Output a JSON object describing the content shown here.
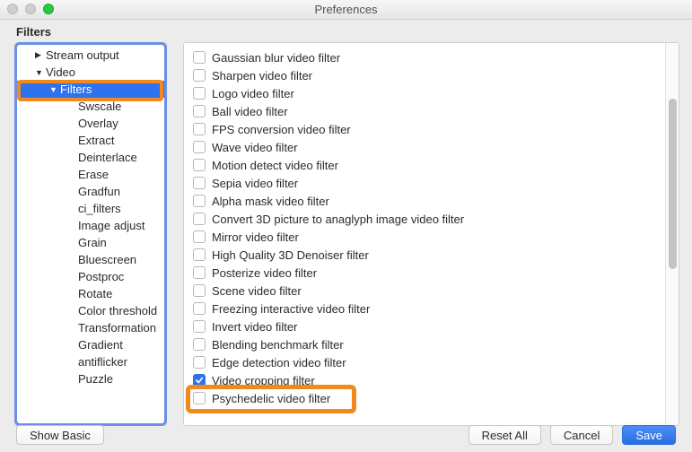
{
  "window": {
    "title": "Preferences"
  },
  "section_title": "Filters",
  "sidebar": {
    "items": [
      {
        "label": "Stream output",
        "arrow": "▶",
        "level": 1,
        "selected": false
      },
      {
        "label": "Video",
        "arrow": "▼",
        "level": 1,
        "selected": false
      },
      {
        "label": "Filters",
        "arrow": "▼",
        "level": 2,
        "selected": true
      },
      {
        "label": "Swscale",
        "arrow": "",
        "level": 3,
        "selected": false
      },
      {
        "label": "Overlay",
        "arrow": "",
        "level": 3,
        "selected": false
      },
      {
        "label": "Extract",
        "arrow": "",
        "level": 3,
        "selected": false
      },
      {
        "label": "Deinterlace",
        "arrow": "",
        "level": 3,
        "selected": false
      },
      {
        "label": "Erase",
        "arrow": "",
        "level": 3,
        "selected": false
      },
      {
        "label": "Gradfun",
        "arrow": "",
        "level": 3,
        "selected": false
      },
      {
        "label": "ci_filters",
        "arrow": "",
        "level": 3,
        "selected": false
      },
      {
        "label": "Image adjust",
        "arrow": "",
        "level": 3,
        "selected": false
      },
      {
        "label": "Grain",
        "arrow": "",
        "level": 3,
        "selected": false
      },
      {
        "label": "Bluescreen",
        "arrow": "",
        "level": 3,
        "selected": false
      },
      {
        "label": "Postproc",
        "arrow": "",
        "level": 3,
        "selected": false
      },
      {
        "label": "Rotate",
        "arrow": "",
        "level": 3,
        "selected": false
      },
      {
        "label": "Color threshold",
        "arrow": "",
        "level": 3,
        "selected": false
      },
      {
        "label": "Transformation",
        "arrow": "",
        "level": 3,
        "selected": false
      },
      {
        "label": "Gradient",
        "arrow": "",
        "level": 3,
        "selected": false
      },
      {
        "label": "antiflicker",
        "arrow": "",
        "level": 3,
        "selected": false
      },
      {
        "label": "Puzzle",
        "arrow": "",
        "level": 3,
        "selected": false
      }
    ]
  },
  "filters": {
    "items": [
      {
        "label": "Gaussian blur video filter",
        "checked": false
      },
      {
        "label": "Sharpen video filter",
        "checked": false
      },
      {
        "label": "Logo video filter",
        "checked": false
      },
      {
        "label": "Ball video filter",
        "checked": false
      },
      {
        "label": "FPS conversion video filter",
        "checked": false
      },
      {
        "label": "Wave video filter",
        "checked": false
      },
      {
        "label": "Motion detect video filter",
        "checked": false
      },
      {
        "label": "Sepia video filter",
        "checked": false
      },
      {
        "label": "Alpha mask video filter",
        "checked": false
      },
      {
        "label": "Convert 3D picture to anaglyph image video filter",
        "checked": false
      },
      {
        "label": "Mirror video filter",
        "checked": false
      },
      {
        "label": "High Quality 3D Denoiser filter",
        "checked": false
      },
      {
        "label": "Posterize video filter",
        "checked": false
      },
      {
        "label": "Scene video filter",
        "checked": false
      },
      {
        "label": "Freezing interactive video filter",
        "checked": false
      },
      {
        "label": "Invert video filter",
        "checked": false
      },
      {
        "label": "Blending benchmark filter",
        "checked": false
      },
      {
        "label": "Edge detection video filter",
        "checked": false
      },
      {
        "label": "Video cropping filter",
        "checked": true
      },
      {
        "label": "Psychedelic video filter",
        "checked": false
      }
    ]
  },
  "buttons": {
    "show_basic": "Show Basic",
    "reset_all": "Reset All",
    "cancel": "Cancel",
    "save": "Save"
  }
}
